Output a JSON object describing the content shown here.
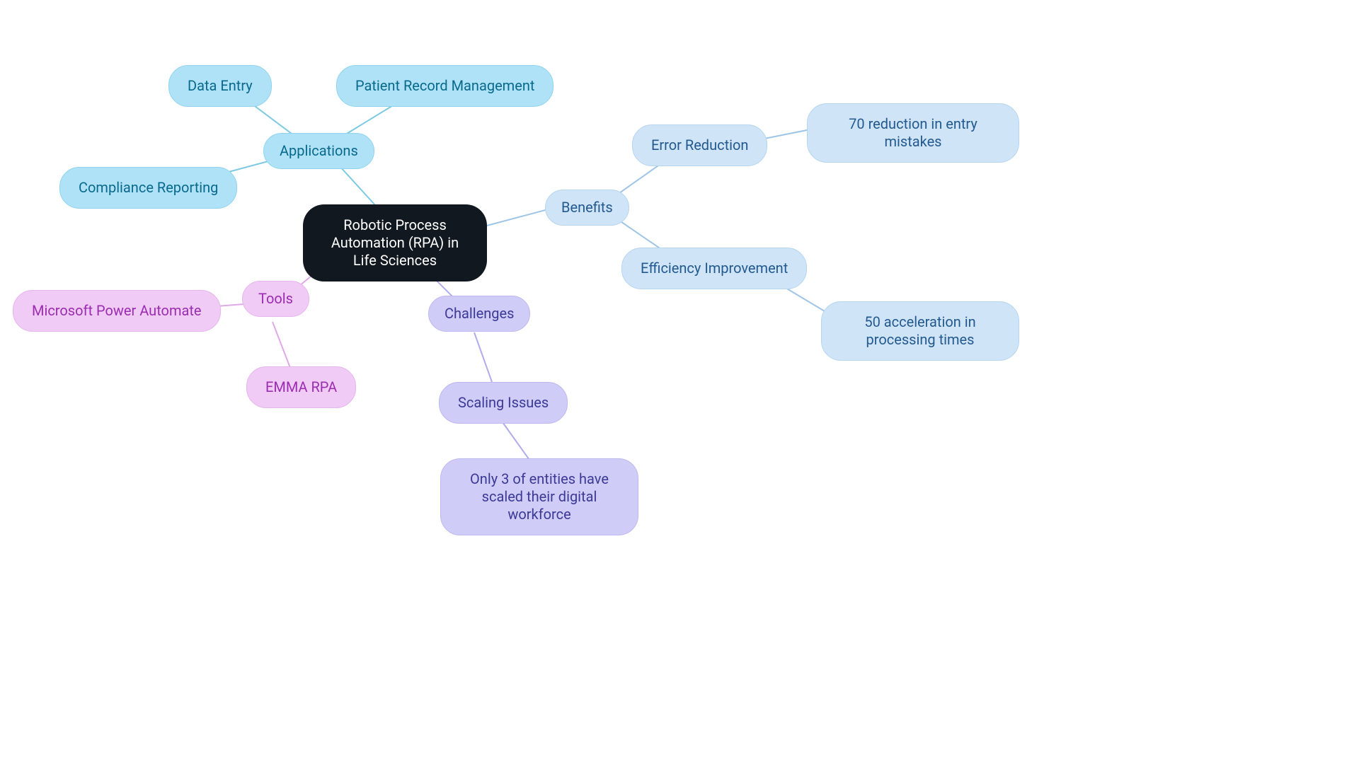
{
  "center": {
    "label": "Robotic Process Automation (RPA) in Life Sciences"
  },
  "benefits": {
    "label": "Benefits",
    "error_reduction": {
      "label": "Error Reduction",
      "detail": "70 reduction in entry mistakes"
    },
    "efficiency": {
      "label": "Efficiency Improvement",
      "detail": "50 acceleration in processing times"
    }
  },
  "applications": {
    "label": "Applications",
    "data_entry": "Data Entry",
    "patient_records": "Patient Record Management",
    "compliance": "Compliance Reporting"
  },
  "tools": {
    "label": "Tools",
    "ms_power_automate": "Microsoft Power Automate",
    "emma": "EMMA RPA"
  },
  "challenges": {
    "label": "Challenges",
    "scaling": {
      "label": "Scaling Issues",
      "detail": "Only 3 of entities have scaled their digital workforce"
    }
  }
}
